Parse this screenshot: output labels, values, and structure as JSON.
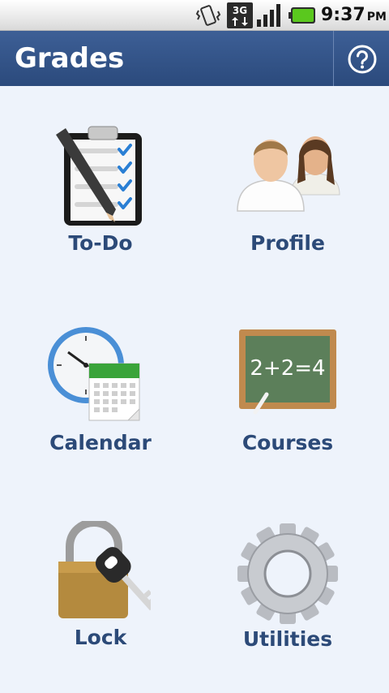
{
  "status_bar": {
    "time": "9:37",
    "ampm": "PM",
    "network": "3G",
    "icons": [
      "vibrate-icon",
      "3g-data-icon",
      "signal-strength-icon",
      "battery-icon"
    ]
  },
  "header": {
    "title": "Grades",
    "help_icon": "help-icon"
  },
  "tiles": [
    {
      "label": "To-Do",
      "icon": "todo-clipboard-icon"
    },
    {
      "label": "Profile",
      "icon": "profile-users-icon"
    },
    {
      "label": "Calendar",
      "icon": "calendar-clock-icon"
    },
    {
      "label": "Courses",
      "icon": "chalkboard-icon"
    },
    {
      "label": "Lock",
      "icon": "padlock-key-icon"
    },
    {
      "label": "Utilities",
      "icon": "gear-icon"
    }
  ],
  "chalkboard_text": "2+2=4",
  "colors": {
    "header_bg": "#2f4f82",
    "background": "#eef3fb",
    "label": "#2c4a78"
  }
}
